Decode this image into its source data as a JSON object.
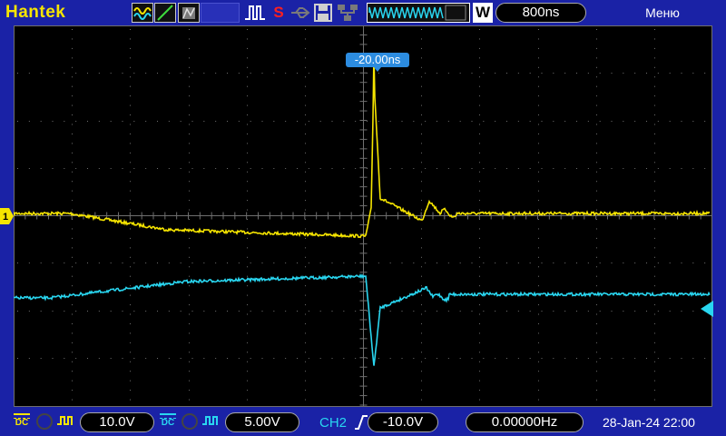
{
  "app": {
    "brand": "Hantek",
    "menu_label": "Меню"
  },
  "toolbar": {
    "icons": [
      "waveform-icon",
      "slope-icon",
      "persistence-icon",
      "blank-slot",
      "pulse-icon",
      "stop-icon",
      "usb-icon",
      "save-icon",
      "lan-icon"
    ],
    "run_state": "S",
    "memory_depth_label": "W",
    "timebase": "800ns"
  },
  "trigger": {
    "time_offset": "-20.00ns",
    "source": "CH2",
    "slope": "rising",
    "level": "-10.0V"
  },
  "channels": {
    "ch1": {
      "coupling": "DC",
      "volts_per_div": "10.0V",
      "color": "#f6e500"
    },
    "ch2": {
      "coupling": "DC",
      "volts_per_div": "5.00V",
      "color": "#29d6f0"
    }
  },
  "status": {
    "frequency": "0.00000Hz",
    "datetime": "28-Jan-24 22:00"
  },
  "colors": {
    "frame": "#1a22a6",
    "screen": "#000000",
    "grid": "#6f6f6f"
  }
}
